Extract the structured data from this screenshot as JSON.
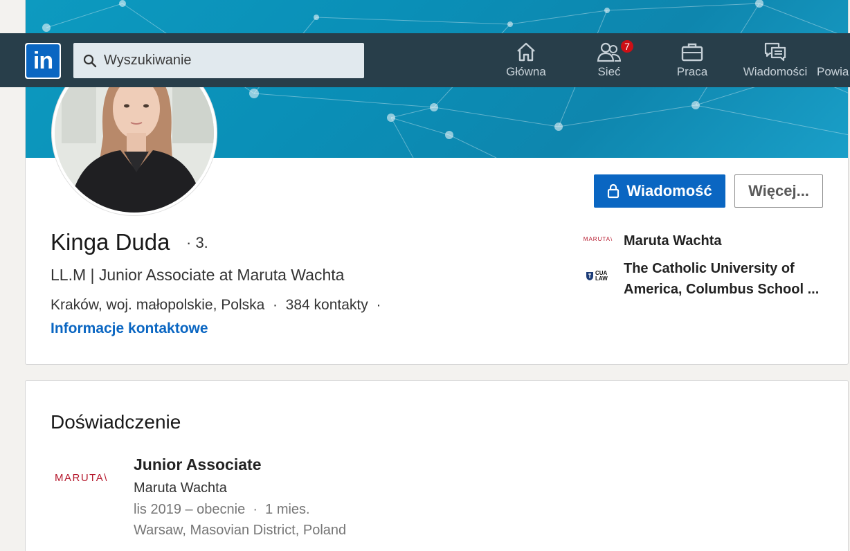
{
  "nav": {
    "logo": "in",
    "search_placeholder": "Wyszukiwanie",
    "items": [
      {
        "label": "Główna",
        "icon": "home-icon"
      },
      {
        "label": "Sieć",
        "icon": "network-icon",
        "badge": "7"
      },
      {
        "label": "Praca",
        "icon": "briefcase-icon"
      },
      {
        "label": "Wiadomości",
        "icon": "messages-icon"
      },
      {
        "label": "Powia",
        "icon": "notifications-icon"
      }
    ]
  },
  "profile": {
    "name": "Kinga Duda",
    "degree": "· 3.",
    "headline": "LL.M | Junior Associate at Maruta Wachta",
    "location": "Kraków, woj. małopolskie, Polska",
    "connections": "384 kontakty",
    "contact_link": "Informacje kontaktowe",
    "message_button": "Wiadomość",
    "more_button": "Więcej...",
    "side_items": [
      {
        "logo": "MARUTA\\",
        "label": "Maruta Wachta"
      },
      {
        "logo": "CUA LAW",
        "label": "The Catholic University of America, Columbus School ..."
      }
    ]
  },
  "experience": {
    "title": "Doświadczenie",
    "items": [
      {
        "logo": "MARUTA\\",
        "role": "Junior Associate",
        "company": "Maruta Wachta",
        "dates": "lis 2019 – obecnie",
        "duration": "1 mies.",
        "location": "Warsaw, Masovian District, Poland"
      }
    ]
  },
  "colors": {
    "navbar": "#283e4a",
    "primary": "#0a66c2",
    "badge": "#cc1016",
    "maruta_red": "#b5172b"
  }
}
